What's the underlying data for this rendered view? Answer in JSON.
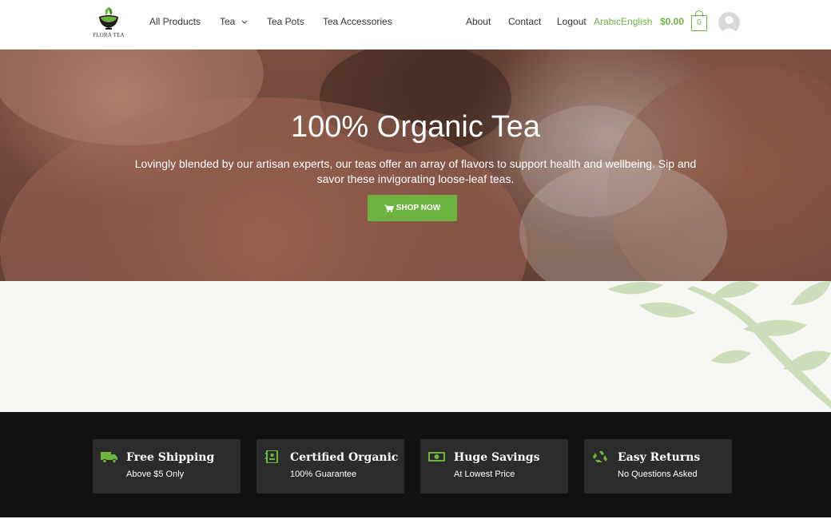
{
  "brand": {
    "name": "FLORA TEA",
    "accent": "#6cb33f"
  },
  "nav": {
    "left": [
      {
        "label": "All Products"
      },
      {
        "label": "Tea"
      },
      {
        "label": "Tea Pots"
      },
      {
        "label": "Tea Accessories"
      }
    ],
    "right": [
      {
        "label": "About"
      },
      {
        "label": "Contact"
      },
      {
        "label": "Logout"
      }
    ],
    "language": "ArabicEnglish",
    "cart_total": "$0.00",
    "cart_count": "0"
  },
  "hero": {
    "title": "100% Organic Tea",
    "subtitle": "Lovingly blended by our artisan experts, our teas offer an array of flavors to support health and wellbeing. Sip and savor these invigorating loose-leaf teas.",
    "cta": "SHOP NOW"
  },
  "features": [
    {
      "icon": "truck-icon",
      "title": "Free Shipping",
      "subtitle": "Above $5 Only"
    },
    {
      "icon": "certificate-icon",
      "title": "Certified Organic",
      "subtitle": "100% Guarantee"
    },
    {
      "icon": "money-icon",
      "title": "Huge Savings",
      "subtitle": "At Lowest Price"
    },
    {
      "icon": "recycle-icon",
      "title": "Easy Returns",
      "subtitle": "No Questions Asked"
    }
  ]
}
